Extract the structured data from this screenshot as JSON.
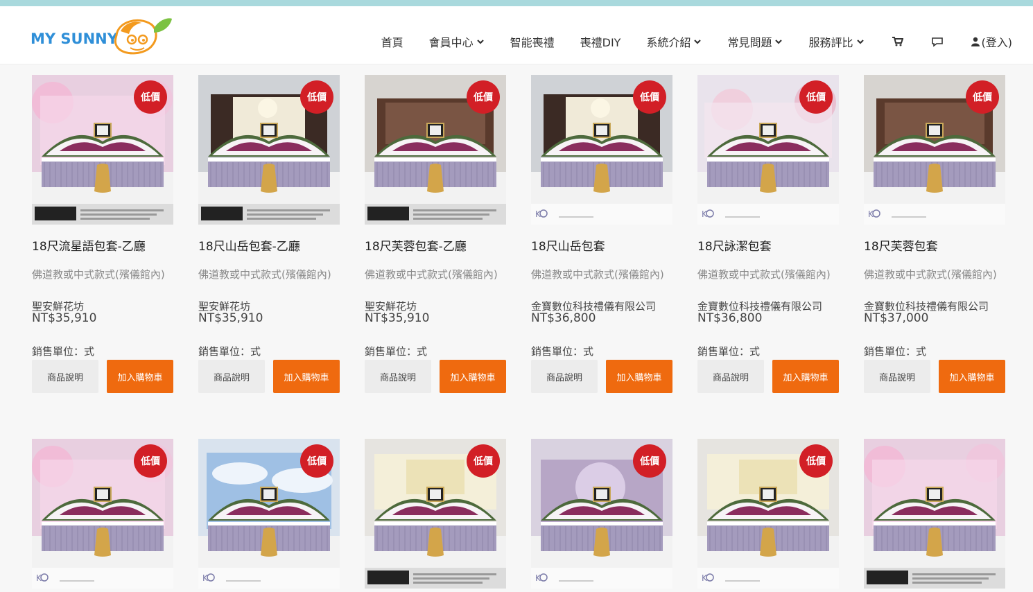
{
  "logo": {
    "text": "MY SUNNY"
  },
  "nav": {
    "items": [
      {
        "label": "首頁",
        "dropdown": false
      },
      {
        "label": "會員中心",
        "dropdown": true
      },
      {
        "label": "智能喪禮",
        "dropdown": false
      },
      {
        "label": "喪禮DIY",
        "dropdown": false
      },
      {
        "label": "系統介紹",
        "dropdown": true
      },
      {
        "label": "常見問題",
        "dropdown": true
      },
      {
        "label": "服務評比",
        "dropdown": true
      }
    ],
    "cart_icon": "shopping-cart-icon",
    "chat_icon": "chat-bubble-icon",
    "login_label": "(登入)",
    "login_icon": "user-icon"
  },
  "colors": {
    "accent": "#ef6a0f",
    "badge": "#d21f26",
    "topline": "#a9d9dd",
    "logo": "#2f8fd8"
  },
  "labels": {
    "badge": "低價",
    "detail_button": "商品說明",
    "cart_button": "加入購物車"
  },
  "products": [
    {
      "title": "18尺流星語包套-乙廳",
      "desc": "佛道教或中式款式(殯儀館內)",
      "vendor": "聖安鮮花坊",
      "price": "NT$35,910",
      "unit": "銷售單位：式",
      "badge": true,
      "style": "pink",
      "footer": "shengan"
    },
    {
      "title": "18尺山岳包套-乙廳",
      "desc": "佛道教或中式款式(殯儀館內)",
      "vendor": "聖安鮮花坊",
      "price": "NT$35,910",
      "unit": "銷售單位：式",
      "badge": true,
      "style": "mountain",
      "footer": "shengan"
    },
    {
      "title": "18尺芙蓉包套-乙廳",
      "desc": "佛道教或中式款式(殯儀館內)",
      "vendor": "聖安鮮花坊",
      "price": "NT$35,910",
      "unit": "銷售單位：式",
      "badge": true,
      "style": "wood",
      "footer": "shengan"
    },
    {
      "title": "18尺山岳包套",
      "desc": "佛道教或中式款式(殯儀館內)",
      "vendor": "金寶數位科技禮儀有限公司",
      "price": "NT$36,800",
      "unit": "銷售單位：式",
      "badge": true,
      "style": "mountain2",
      "footer": "kb"
    },
    {
      "title": "18尺詠潔包套",
      "desc": "佛道教或中式款式(殯儀館內)",
      "vendor": "金寶數位科技禮儀有限公司",
      "price": "NT$36,800",
      "unit": "銷售單位：式",
      "badge": true,
      "style": "blossom",
      "footer": "kb"
    },
    {
      "title": "18尺芙蓉包套",
      "desc": "佛道教或中式款式(殯儀館內)",
      "vendor": "金寶數位科技禮儀有限公司",
      "price": "NT$37,000",
      "unit": "銷售單位：式",
      "badge": true,
      "style": "wood",
      "footer": "kb"
    },
    {
      "title": "",
      "desc": "",
      "vendor": "",
      "price": "",
      "unit": "",
      "badge": true,
      "style": "pink",
      "footer": "kb"
    },
    {
      "title": "",
      "desc": "",
      "vendor": "",
      "price": "",
      "unit": "",
      "badge": true,
      "style": "sky",
      "footer": "kb"
    },
    {
      "title": "",
      "desc": "",
      "vendor": "",
      "price": "",
      "unit": "",
      "badge": true,
      "style": "wall",
      "footer": "shengan"
    },
    {
      "title": "",
      "desc": "",
      "vendor": "",
      "price": "",
      "unit": "",
      "badge": true,
      "style": "purple",
      "footer": "kb"
    },
    {
      "title": "",
      "desc": "",
      "vendor": "",
      "price": "",
      "unit": "",
      "badge": true,
      "style": "wall2",
      "footer": "kb"
    },
    {
      "title": "",
      "desc": "",
      "vendor": "",
      "price": "",
      "unit": "",
      "badge": false,
      "style": "pink",
      "footer": "shengan"
    }
  ]
}
